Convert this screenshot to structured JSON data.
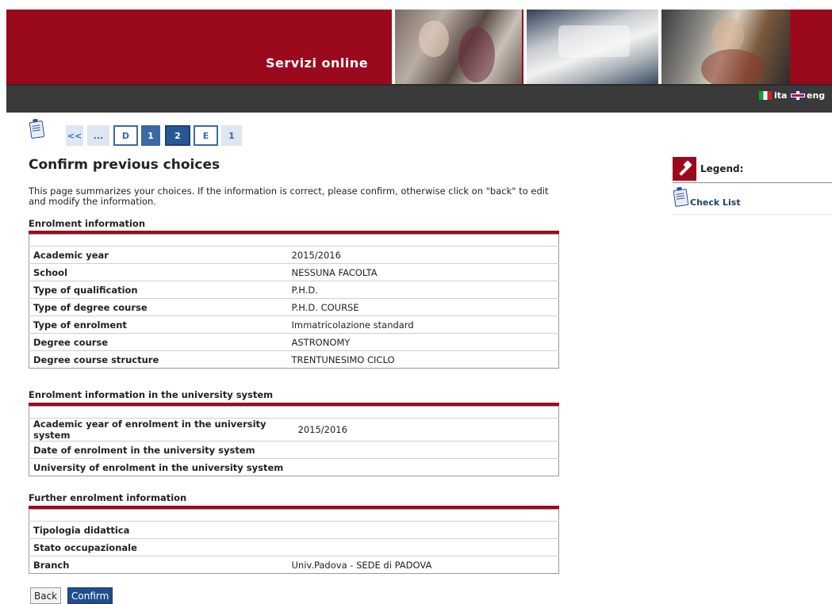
{
  "header": {
    "brand": "Servizi online",
    "languages": [
      {
        "label": "ita",
        "flag": "flag-it-icon"
      },
      {
        "label": "eng",
        "flag": "flag-uk-icon"
      }
    ],
    "colors": {
      "brand_red": "#9b0a1c",
      "dark_bar": "#3a3a3a",
      "step_blue": "#3a6aa6"
    }
  },
  "steps": {
    "icon": "check-list-icon",
    "items": [
      "<<",
      "...",
      "D",
      "1",
      "2",
      "E",
      "1"
    ],
    "current": "2"
  },
  "page": {
    "title": "Confirm previous choices",
    "intro": "This page summarizes your choices. If the information is correct, please confirm, otherwise click on \"back\" to edit and modify the information."
  },
  "sections": [
    {
      "title": "Enrolment information",
      "rows": [
        {
          "label": "Academic year",
          "value": "2015/2016"
        },
        {
          "label": "School",
          "value": "NESSUNA FACOLTA"
        },
        {
          "label": "Type of qualification",
          "value": "P.H.D."
        },
        {
          "label": "Type of degree course",
          "value": "P.H.D. COURSE"
        },
        {
          "label": "Type of enrolment",
          "value": "Immatricolazione standard"
        },
        {
          "label": "Degree course",
          "value": "ASTRONOMY"
        },
        {
          "label": "Degree course structure",
          "value": "TRENTUNESIMO CICLO"
        }
      ]
    },
    {
      "title": "Enrolment information in the university system",
      "rows": [
        {
          "label": "Academic year of enrolment in the university system",
          "value": "2015/2016"
        },
        {
          "label": "Date of enrolment in the university system",
          "value": ""
        },
        {
          "label": "University of enrolment in the university system",
          "value": ""
        }
      ]
    },
    {
      "title": "Further enrolment information",
      "rows": [
        {
          "label": "Tipologia didattica",
          "value": ""
        },
        {
          "label": "Stato occupazionale",
          "value": ""
        },
        {
          "label": "Branch",
          "value": "Univ.Padova - SEDE di PADOVA"
        }
      ]
    }
  ],
  "buttons": {
    "back": "Back",
    "confirm": "Confirm"
  },
  "legend": {
    "title": "Legend:",
    "icon": "pin-icon",
    "items": [
      {
        "label": "Check List",
        "icon": "check-list-icon"
      }
    ]
  }
}
